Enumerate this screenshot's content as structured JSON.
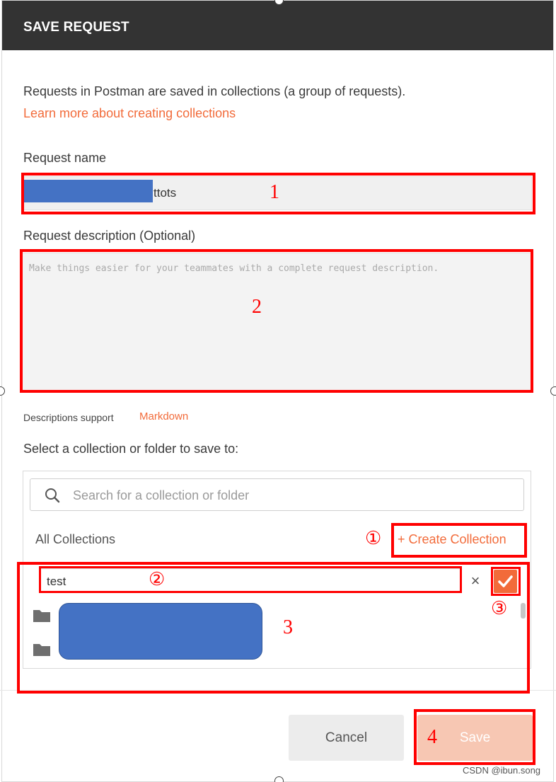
{
  "dialog": {
    "title": "SAVE REQUEST",
    "intro_text": "Requests in Postman are saved in collections (a group of requests).",
    "learn_more_link": "Learn more about creating collections"
  },
  "request_name": {
    "label": "Request name",
    "value_suffix": "ttots"
  },
  "request_description": {
    "label": "Request description (Optional)",
    "placeholder": "Make things easier for your teammates with a complete request description.",
    "support_text": "Descriptions support",
    "markdown_link": "Markdown"
  },
  "collection": {
    "label": "Select a collection or folder to save to:",
    "search_placeholder": "Search for a collection or folder",
    "all_collections": "All Collections",
    "create_collection": "+ Create Collection",
    "new_collection_value": "test",
    "clear_symbol": "×",
    "list_items": [
      {
        "icon": "folder-icon"
      },
      {
        "icon": "folder-icon"
      }
    ]
  },
  "footer": {
    "cancel_label": "Cancel",
    "save_label": "Save"
  },
  "annotations": {
    "n1": "1",
    "n2": "2",
    "n3": "3",
    "n4": "4",
    "c1": "①",
    "c2": "②",
    "c3": "③"
  },
  "watermark": "CSDN @ibun.song",
  "colors": {
    "header_bg": "#333333",
    "accent": "#f26b3a",
    "save_disabled": "#f7c7b3",
    "annotation_red": "#ff0000",
    "redaction_blue": "#4472c4"
  }
}
